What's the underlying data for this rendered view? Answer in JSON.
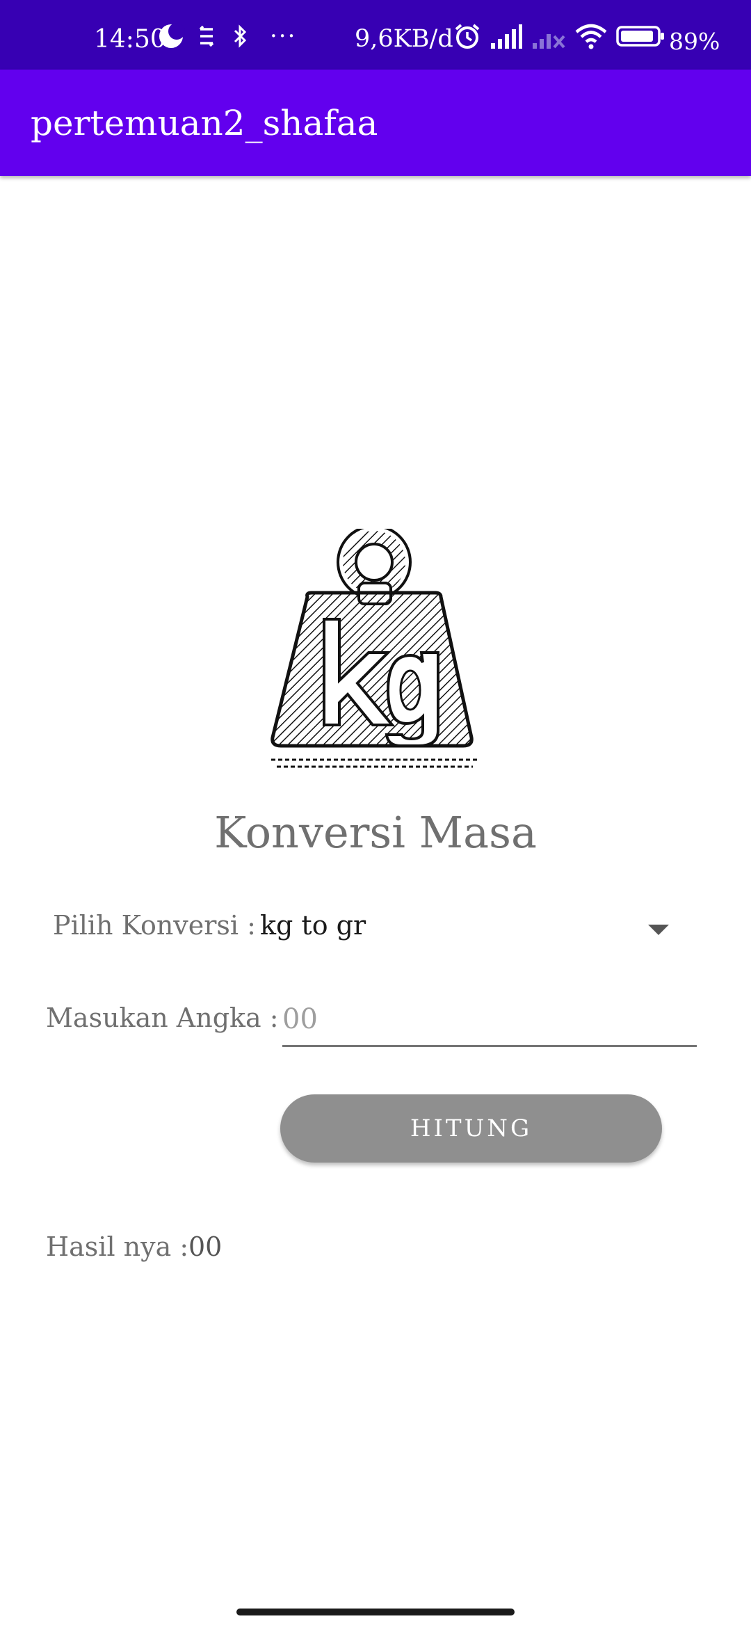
{
  "status_bar": {
    "time": "14:50",
    "network_speed": "9,6KB/d",
    "battery": "89%",
    "overflow": "···",
    "icons": [
      "moon-icon",
      "sync-icon",
      "bluetooth-icon",
      "alarm-icon",
      "signal-icon",
      "signal-empty-icon",
      "wifi-icon",
      "battery-icon"
    ]
  },
  "app_bar": {
    "title": "pertemuan2_shafaa"
  },
  "main": {
    "image": "kg-weight-icon",
    "title": "Konversi Masa",
    "conversion_label": "Pilih Konversi :",
    "conversion_value": "kg to gr",
    "input_label": "Masukan Angka :",
    "input_placeholder": "00",
    "button_label": "HITUNG",
    "result_label": "Hasil nya :",
    "result_value": "00"
  },
  "colors": {
    "status_bar": "#3700b3",
    "app_bar": "#6200ee",
    "button": "#8f8f8f"
  }
}
